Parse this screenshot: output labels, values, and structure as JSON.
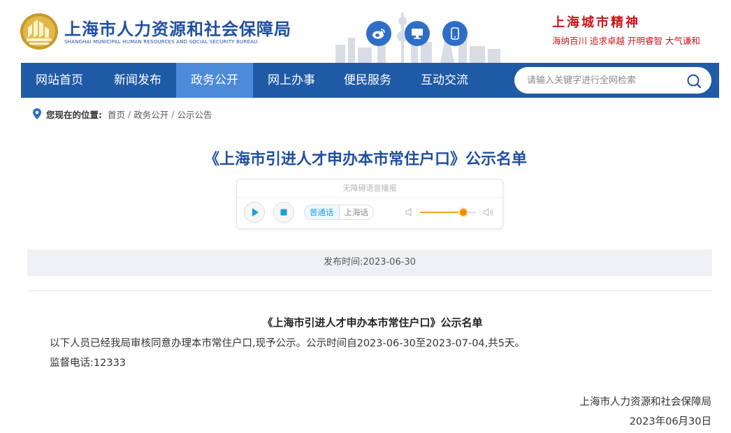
{
  "header": {
    "site_name": "上海市人力资源和社会保障局",
    "site_name_en": "SHANGHAI MUNICIPAL HUMAN RESOURCES AND SOCIAL SECURITY BUREAU",
    "social_icons": [
      "weibo-icon",
      "desktop-icon",
      "mobile-icon"
    ],
    "spirit_title": "上海城市精神",
    "spirit_line": "海纳百川 追求卓越 开明睿智 大气谦和",
    "colors": {
      "brand_blue": "#1f4fa1",
      "spirit_red": "#c8161d"
    }
  },
  "nav": {
    "items": [
      {
        "label": "网站首页"
      },
      {
        "label": "新闻发布"
      },
      {
        "label": "政务公开",
        "active": true
      },
      {
        "label": "网上办事"
      },
      {
        "label": "便民服务"
      },
      {
        "label": "互动交流"
      }
    ],
    "search_placeholder": "请输入关键字进行全网检索",
    "colors": {
      "bar": "#1f5aa6",
      "active": "#4d8ad8"
    }
  },
  "breadcrumb": {
    "label": "您现在的位置:",
    "items": [
      "首页",
      "政务公开",
      "公示公告"
    ],
    "separator": "/"
  },
  "article": {
    "title": "《上海市引进人才申办本市常住户口》公示名单",
    "player": {
      "heading": "无障碍语音播报",
      "lang_mandarin": "普通话",
      "lang_shanghainese": "上海话",
      "volume": 0.78
    },
    "publish_label": "发布时间:",
    "publish_date": "2023-06-30",
    "body_title": "《上海市引进人才申办本市常住户口》公示名单",
    "body_paragraph": "以下人员已经我局审核同意办理本市常住户口,现予公示。公示时间自2023-06-30至2023-07-04,共5天。",
    "phone_label": "监督电话:",
    "phone": "12333",
    "sign_org": "上海市人力资源和社会保障局",
    "sign_date": "2023年06月30日"
  }
}
